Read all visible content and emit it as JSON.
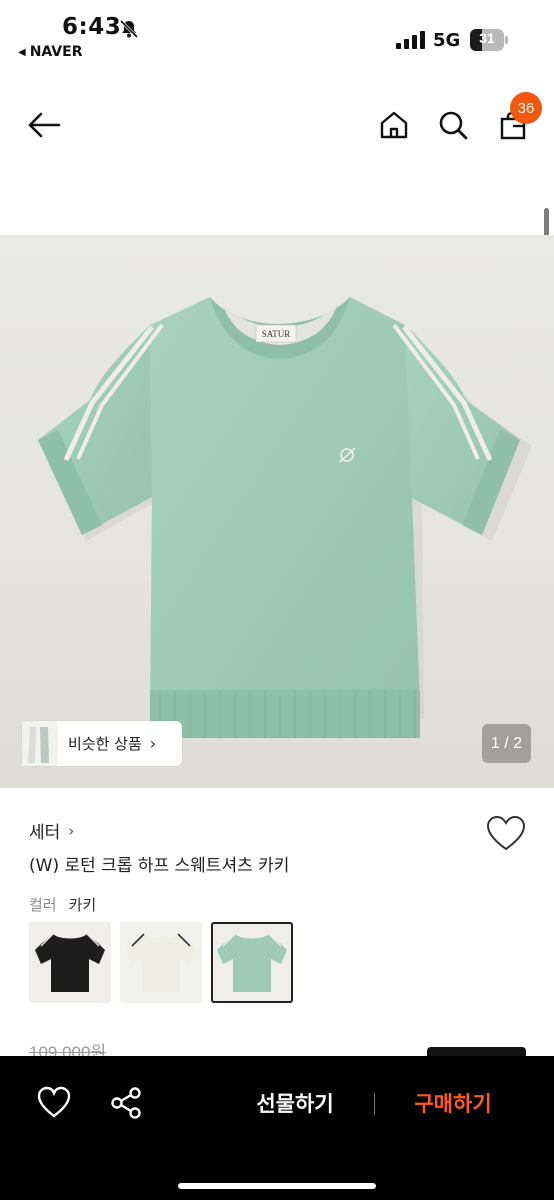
{
  "status_bar": {
    "time": "6:43",
    "back_app": "NAVER",
    "network": "5G",
    "battery": "31"
  },
  "header": {
    "cart_count": "36"
  },
  "gallery": {
    "brand_label_on_image": "SATUR",
    "similar_button": "비슷한 상품",
    "page_indicator": "1 / 2",
    "product_color": "#9fcbb6"
  },
  "product": {
    "category": "세터",
    "name": "(W) 로턴 크롭 하프 스웨트셔츠 카키",
    "color_label": "컬러",
    "color_value": "카키",
    "swatches": [
      {
        "name": "black",
        "color": "#1d1d1d",
        "selected": false
      },
      {
        "name": "cream",
        "color": "#efeee2",
        "selected": false
      },
      {
        "name": "mint",
        "color": "#9fcbb6",
        "selected": true
      }
    ],
    "original_price": "109,000원"
  },
  "bottom_bar": {
    "gift_label": "선물하기",
    "buy_label": "구매하기",
    "buy_color": "#ff5a1e"
  }
}
